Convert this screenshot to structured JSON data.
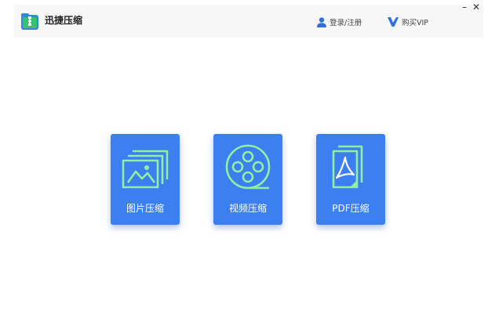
{
  "app": {
    "title": "迅捷压缩"
  },
  "header": {
    "login_label": "登录/注册",
    "vip_label": "购买VIP"
  },
  "window_controls": {
    "minimize": "–",
    "close": "✕"
  },
  "tools": [
    {
      "label": "图片压缩",
      "icon": "image-icon"
    },
    {
      "label": "视频压缩",
      "icon": "film-reel-icon"
    },
    {
      "label": "PDF压缩",
      "icon": "pdf-file-icon"
    }
  ],
  "colors": {
    "accent": "#3c7ff1",
    "icon_green": "#8ef0a0",
    "vip_blue": "#2f6fe0"
  }
}
